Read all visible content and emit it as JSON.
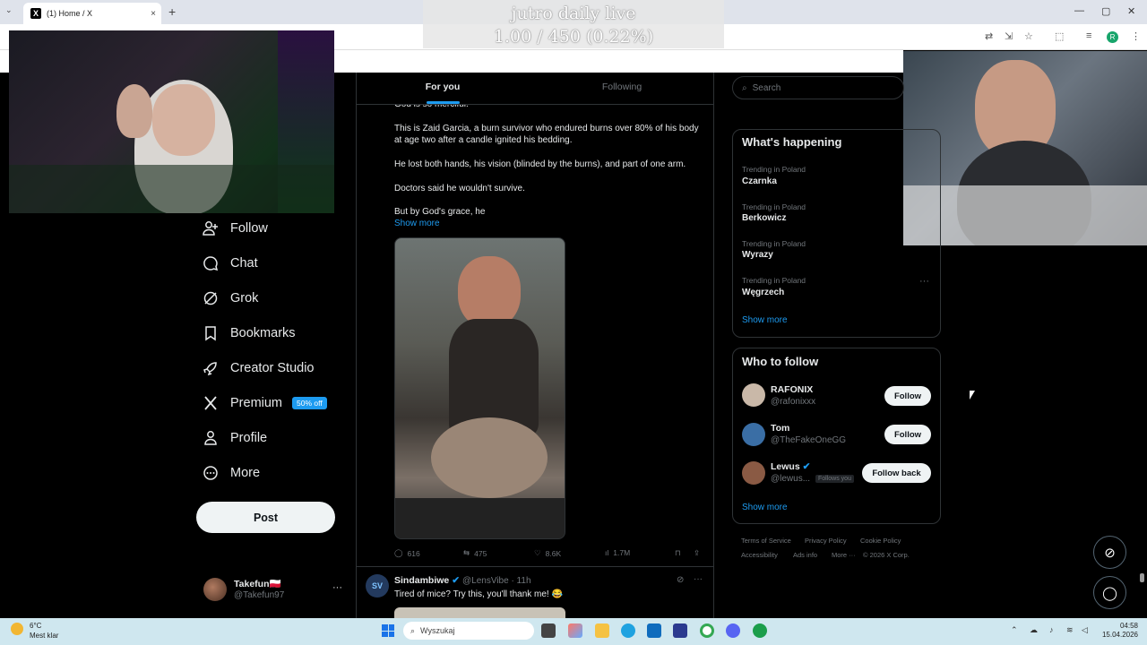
{
  "browser": {
    "tab_title": "(1) Home / X",
    "tab_close": "×",
    "new_tab": "+",
    "window_min": "—",
    "window_max": "▢",
    "window_close": "✕",
    "profile_initial": "R"
  },
  "stream_overlay": {
    "title": "jutro daily live",
    "progress_text": "1.00 / 450 (0.22%)"
  },
  "nav": {
    "items": [
      {
        "label": "Follow",
        "icon": "follow-icon"
      },
      {
        "label": "Chat",
        "icon": "chat-icon"
      },
      {
        "label": "Grok",
        "icon": "grok-icon"
      },
      {
        "label": "Bookmarks",
        "icon": "bookmark-icon"
      },
      {
        "label": "Creator Studio",
        "icon": "rocket-icon"
      },
      {
        "label": "Premium",
        "icon": "x-logo-icon"
      },
      {
        "label": "Profile",
        "icon": "person-icon"
      },
      {
        "label": "More",
        "icon": "more-circle-icon"
      }
    ],
    "premium_badge": "50% off",
    "post_label": "Post"
  },
  "account": {
    "name": "Takefun🇵🇱",
    "handle": "@Takefun97",
    "more": "···"
  },
  "feed": {
    "tab_for_you": "For you",
    "tab_following": "Following",
    "post1": {
      "cut_line": "God is so merciful.",
      "para1": "This is Zaid Garcia, a burn survivor who endured burns over 80% of his body at age two after a candle ignited his bedding.",
      "para2": "He lost both hands, his vision (blinded by the burns), and part of one arm.",
      "para3": "Doctors said he wouldn't survive.",
      "para4": "But by God's grace, he",
      "show_more": "Show more",
      "replies": "616",
      "reposts": "475",
      "likes": "8.6K",
      "views": "1.7M"
    },
    "post2": {
      "avatar_text": "SV",
      "name": "Sindambiwe",
      "handle_time": "@LensVibe · 11h",
      "text": "Tired of mice? Try this, you'll thank me! 😂"
    }
  },
  "right": {
    "search_placeholder": "Search",
    "happening_title": "What's happening",
    "trends": [
      {
        "meta": "Trending in Poland",
        "name": "Czarnka"
      },
      {
        "meta": "Trending in Poland",
        "name": "Berkowicz"
      },
      {
        "meta": "Trending in Poland",
        "name": "Wyrazy"
      },
      {
        "meta": "Trending in Poland",
        "name": "Węgrzech"
      }
    ],
    "trend_more": "···",
    "show_more": "Show more",
    "who_title": "Who to follow",
    "who": [
      {
        "name": "RAFONIX",
        "handle": "@rafonixxx",
        "button": "Follow",
        "color": "#c9b8a8"
      },
      {
        "name": "Tom",
        "handle": "@TheFakeOneGG",
        "button": "Follow",
        "color": "#3a6ea5"
      },
      {
        "name": "Lewus",
        "handle": "@lewus...",
        "button": "Follow back",
        "color": "#8a5a44"
      }
    ],
    "follows_you": "Follows you",
    "who_show_more": "Show more",
    "footer": {
      "tos": "Terms of Service",
      "privacy": "Privacy Policy",
      "cookie": "Cookie Policy",
      "accessibility": "Accessibility",
      "ads": "Ads info",
      "more": "More ···",
      "copyright": "© 2026 X Corp."
    }
  },
  "taskbar": {
    "temp": "6°C",
    "weather": "Mest klar",
    "search": "Wyszukaj",
    "time": "04:58",
    "date": "15.04.2026"
  },
  "colors": {
    "accent": "#1d9bf0",
    "background": "#000000",
    "border": "#2f3336",
    "muted": "#71767b"
  }
}
